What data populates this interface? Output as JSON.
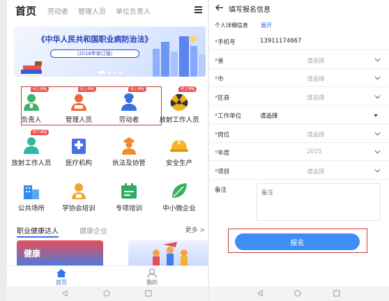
{
  "left": {
    "tabs": [
      "首页",
      "劳动者",
      "管理人员",
      "单位负责人"
    ],
    "banner": {
      "title": "《中华人民共和国职业病防治法》",
      "subtitle": "（2018年修订版）"
    },
    "grid": [
      {
        "label": "负责人",
        "badge": "线上课程",
        "icon": "person-icon",
        "color": "#3fb26b"
      },
      {
        "label": "管理人员",
        "badge": "线上课程",
        "icon": "person-icon",
        "color": "#ef6a3a"
      },
      {
        "label": "劳动者",
        "badge": "线上课程",
        "icon": "person-icon",
        "color": "#3a6fe0"
      },
      {
        "label": "放射工作人员",
        "badge": "线上课程",
        "icon": "radiation-icon",
        "color": "#f0b020"
      },
      {
        "label": "放射工作人员",
        "badge": "线下课程",
        "icon": "person-icon",
        "color": "#2fb6a8"
      },
      {
        "label": "医疗机构",
        "badge": "",
        "icon": "hospital-icon",
        "color": "#4a6fe2"
      },
      {
        "label": "执法及协管",
        "badge": "",
        "icon": "officer-icon",
        "color": "#f08a2c"
      },
      {
        "label": "安全生产",
        "badge": "",
        "icon": "helmet-icon",
        "color": "#f5b325"
      },
      {
        "label": "公共场所",
        "badge": "",
        "icon": "building-icon",
        "color": "#2f8fe8"
      },
      {
        "label": "学协会培训",
        "badge": "",
        "icon": "training-icon",
        "color": "#f5a62a"
      },
      {
        "label": "专项培训",
        "badge": "",
        "icon": "calendar-icon",
        "color": "#2faa61"
      },
      {
        "label": "中小微企业",
        "badge": "",
        "icon": "leaf-icon",
        "color": "#37b05c"
      }
    ],
    "section": {
      "active": "职业健康达人",
      "inactive": "健康企业",
      "more": "更多 >"
    },
    "card1_text": "健康",
    "nav": [
      {
        "label": "首页",
        "icon": "home-icon"
      },
      {
        "label": "我的",
        "icon": "user-icon"
      }
    ]
  },
  "right": {
    "header_title": "填写报名信息",
    "section_label": "个人详细信息",
    "expand": "展开",
    "rows": [
      {
        "label": "手机号",
        "value": "13911174667",
        "placeholder": "",
        "control": "text"
      },
      {
        "label": "省",
        "value": "",
        "placeholder": "请选择",
        "control": "chevron"
      },
      {
        "label": "市",
        "value": "",
        "placeholder": "请选择",
        "control": "chevron"
      },
      {
        "label": "区县",
        "value": "",
        "placeholder": "请选择",
        "control": "chevron"
      },
      {
        "label": "工作单位",
        "value": "请选择",
        "placeholder": "",
        "control": "caret"
      },
      {
        "label": "岗位",
        "value": "",
        "placeholder": "请选择",
        "control": "chevron"
      },
      {
        "label": "年度",
        "value": "",
        "placeholder": "2025",
        "control": "chevron"
      },
      {
        "label": "项目",
        "value": "",
        "placeholder": "请选择",
        "control": "chevron"
      }
    ],
    "notes_label": "备注",
    "notes_placeholder": "备注",
    "submit_label": "报名"
  }
}
